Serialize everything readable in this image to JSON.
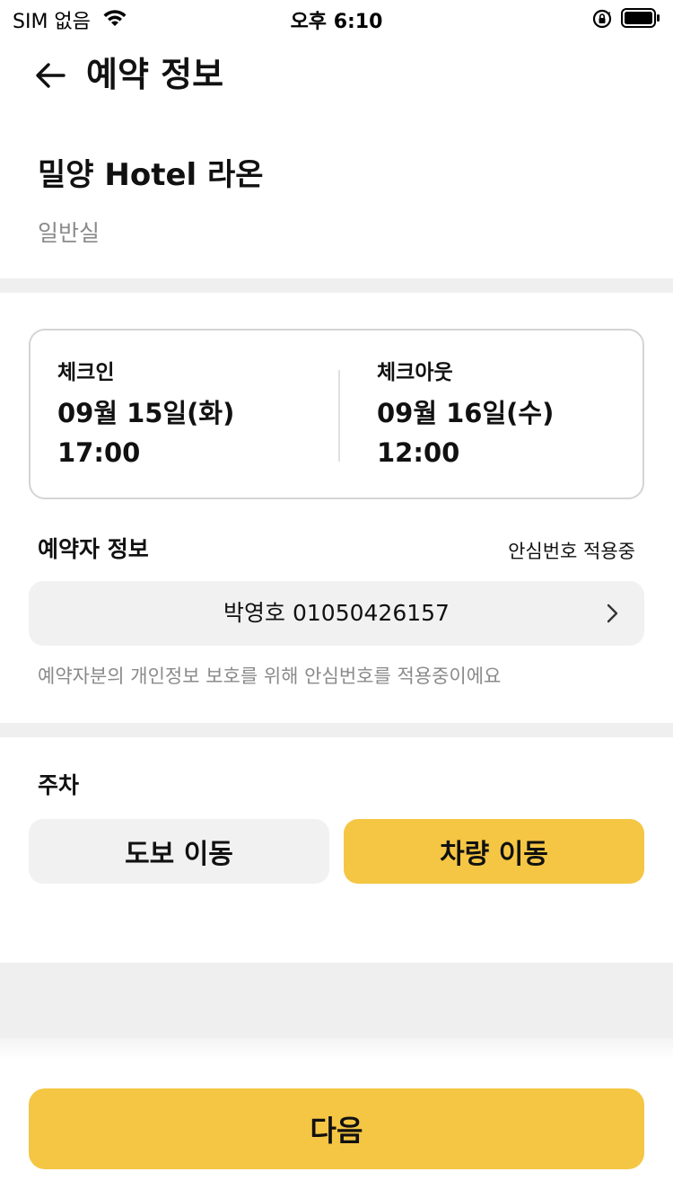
{
  "status_bar": {
    "carrier": "SIM 없음",
    "time": "오후 6:10",
    "icons": [
      "wifi-icon",
      "orientation-lock-icon",
      "battery-icon"
    ]
  },
  "header": {
    "back_icon": "arrow-left-icon",
    "title": "예약 정보"
  },
  "hotel": {
    "name": "밀양 Hotel 라온",
    "room_type": "일반실"
  },
  "check_in": {
    "label": "체크인",
    "date": "09월 15일(화)",
    "time": "17:00"
  },
  "check_out": {
    "label": "체크아웃",
    "date": "09월 16일(수)",
    "time": "12:00"
  },
  "booker": {
    "label": "예약자 정보",
    "safe_number_status": "안심번호 적용중",
    "value": "박영호 01050426157",
    "note": "예약자분의 개인정보 보호를 위해 안심번호를 적용중이에요"
  },
  "parking": {
    "label": "주차",
    "options": [
      {
        "label": "도보 이동",
        "selected": false
      },
      {
        "label": "차량 이동",
        "selected": true
      }
    ]
  },
  "next_label": "다음",
  "colors": {
    "accent": "#f5c644",
    "field_bg": "#f1f1f1",
    "divider": "#efefef",
    "muted_text": "#8a8a8a"
  }
}
